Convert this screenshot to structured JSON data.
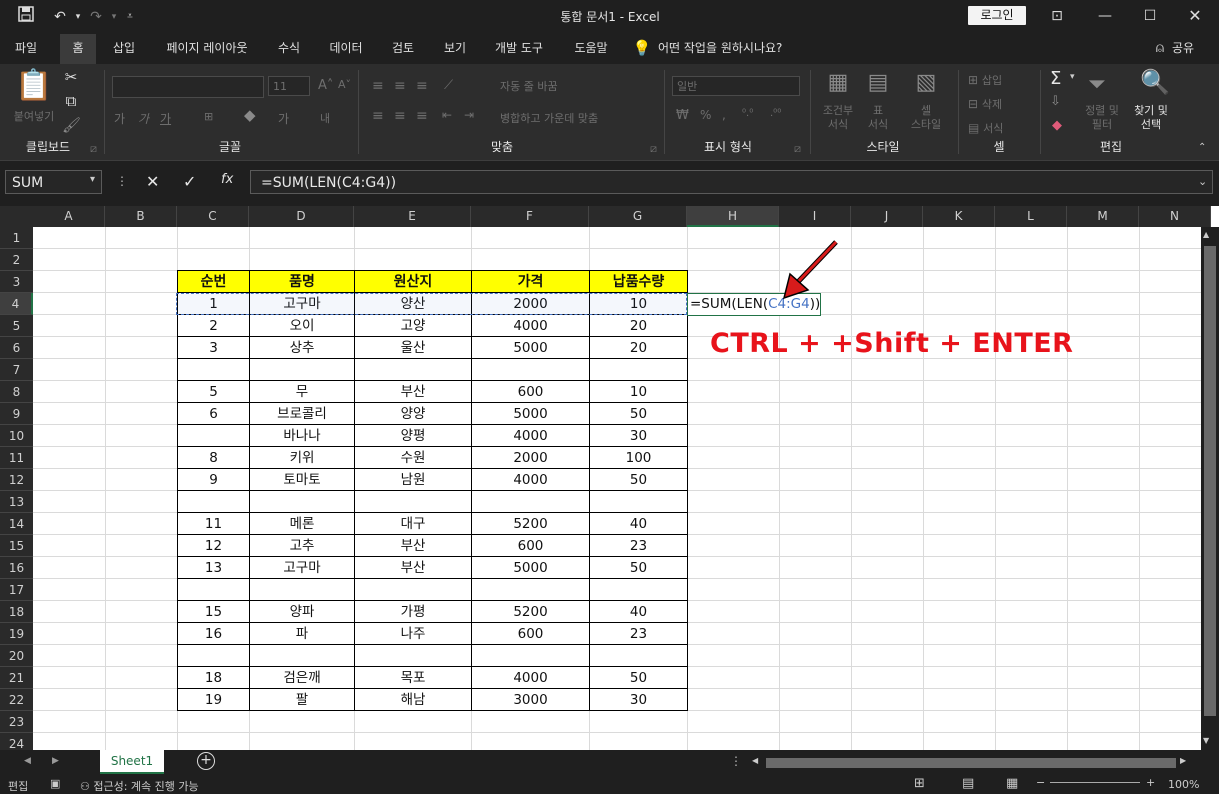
{
  "window": {
    "title": "통합 문서1  -  Excel",
    "login_label": "로그인",
    "controls": [
      "ribbon-display-icon",
      "minimize-icon",
      "restore-icon",
      "close-icon"
    ]
  },
  "tabs": [
    {
      "label": "파일"
    },
    {
      "label": "홈",
      "active": true
    },
    {
      "label": "삽입"
    },
    {
      "label": "페이지 레이아웃"
    },
    {
      "label": "수식"
    },
    {
      "label": "데이터"
    },
    {
      "label": "검토"
    },
    {
      "label": "보기"
    },
    {
      "label": "개발 도구"
    },
    {
      "label": "도움말"
    }
  ],
  "tell_me": "어떤 작업을 원하시나요?",
  "share_label": "공유",
  "ribbon": {
    "groups": [
      "클립보드",
      "글꼴",
      "맞춤",
      "표시 형식",
      "스타일",
      "셀",
      "편집"
    ],
    "paste_label": "붙여넣기",
    "font_size": "11",
    "wrap_text": "자동 줄 바꿈",
    "merge_center": "병합하고 가운데 맞춤",
    "number_format": "일반",
    "cond_format": [
      "조건부",
      "서식"
    ],
    "table_format": [
      "표",
      "서식"
    ],
    "cell_style": [
      "셀",
      "스타일"
    ],
    "insert_label": "삽입",
    "delete_label": "삭제",
    "format_label": "서식",
    "sort_filter": [
      "정렬 및",
      "필터"
    ],
    "find_select": [
      "찾기 및",
      "선택"
    ]
  },
  "formula_bar": {
    "name_box": "SUM",
    "formula": "=SUM(LEN(C4:G4))"
  },
  "columns": [
    "A",
    "B",
    "C",
    "D",
    "E",
    "F",
    "G",
    "H",
    "I",
    "J",
    "K",
    "L",
    "M",
    "N"
  ],
  "rows": [
    "1",
    "2",
    "3",
    "4",
    "5",
    "6",
    "7",
    "8",
    "9",
    "10",
    "11",
    "12",
    "13",
    "14",
    "15",
    "16",
    "17",
    "18",
    "19",
    "20",
    "21",
    "22",
    "23",
    "24"
  ],
  "table": {
    "headers": [
      "순번",
      "품명",
      "원산지",
      "가격",
      "납품수량"
    ],
    "rows": [
      [
        "1",
        "고구마",
        "양산",
        "2000",
        "10"
      ],
      [
        "2",
        "오이",
        "고양",
        "4000",
        "20"
      ],
      [
        "3",
        "상추",
        "울산",
        "5000",
        "20"
      ],
      [
        "",
        "",
        "",
        "",
        ""
      ],
      [
        "5",
        "무",
        "부산",
        "600",
        "10"
      ],
      [
        "6",
        "브로콜리",
        "양양",
        "5000",
        "50"
      ],
      [
        "",
        "바나나",
        "양평",
        "4000",
        "30"
      ],
      [
        "8",
        "키위",
        "수원",
        "2000",
        "100"
      ],
      [
        "9",
        "토마토",
        "남원",
        "4000",
        "50"
      ],
      [
        "",
        "",
        "",
        "",
        ""
      ],
      [
        "11",
        "메론",
        "대구",
        "5200",
        "40"
      ],
      [
        "12",
        "고추",
        "부산",
        "600",
        "23"
      ],
      [
        "13",
        "고구마",
        "부산",
        "5000",
        "50"
      ],
      [
        "",
        "",
        "",
        "",
        ""
      ],
      [
        "15",
        "양파",
        "가평",
        "5200",
        "40"
      ],
      [
        "16",
        "파",
        "나주",
        "600",
        "23"
      ],
      [
        "",
        "",
        "",
        "",
        ""
      ],
      [
        "18",
        "검은깨",
        "목포",
        "4000",
        "50"
      ],
      [
        "19",
        "팔",
        "해남",
        "3000",
        "30"
      ]
    ]
  },
  "edit_cell": {
    "prefix": "=SUM(LEN(",
    "range": "C4:G4",
    "suffix": "))"
  },
  "annotation": {
    "text": "CTRL + +Shift + ENTER",
    "color": "#e8131b"
  },
  "sheet_tab": "Sheet1",
  "status": {
    "mode": "편집",
    "accessibility": "접근성: 계속 진행 가능",
    "zoom": "100%"
  },
  "colors": {
    "header_fill": "#ffff00",
    "selection": "#217346",
    "range_blue": "#4472c4"
  }
}
